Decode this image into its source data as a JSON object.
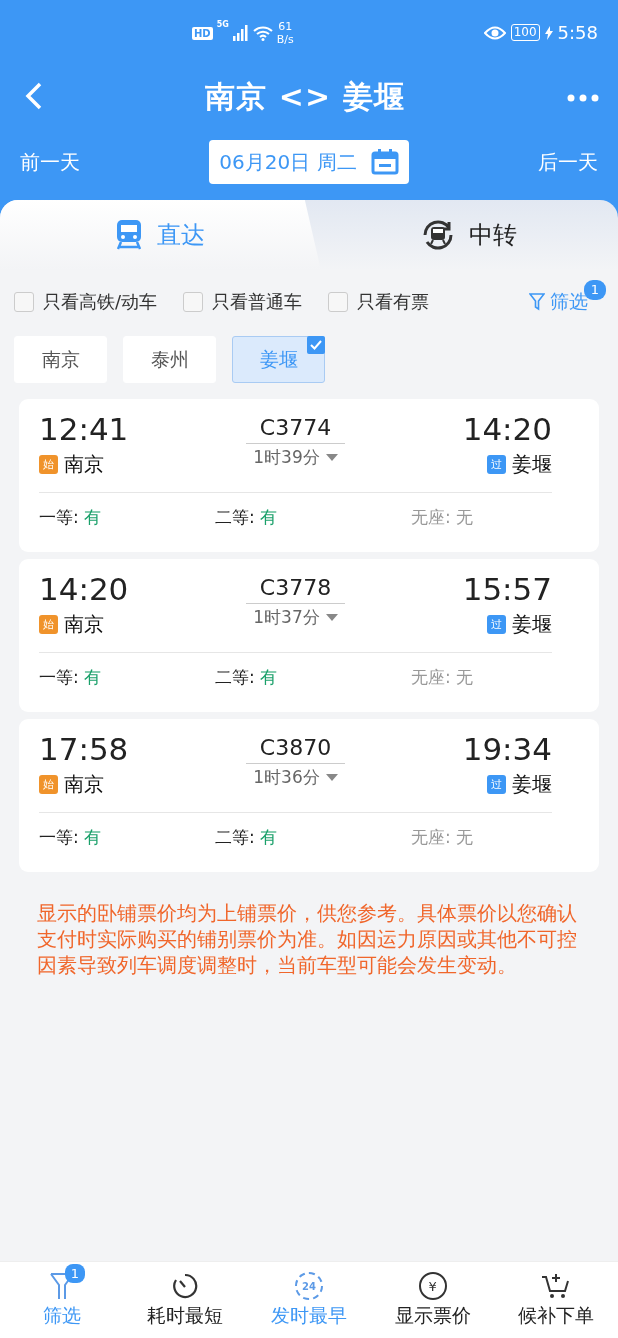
{
  "status_bar": {
    "hd": "HD",
    "network": "5G",
    "speed": "61",
    "speed_unit": "B/s",
    "battery": "100",
    "time": "5:58"
  },
  "header": {
    "title": "南京 <> 姜堰",
    "prev_day": "前一天",
    "date": "06月20日 周二",
    "next_day": "后一天"
  },
  "tabs": [
    {
      "label": "直达",
      "kind": "train",
      "selected": true
    },
    {
      "label": "中转",
      "kind": "transfer",
      "selected": false
    }
  ],
  "filters": [
    {
      "label": "只看高铁/动车",
      "checked": false
    },
    {
      "label": "只看普通车",
      "checked": false
    },
    {
      "label": "只看有票",
      "checked": false
    }
  ],
  "filter_button": {
    "label": "筛选",
    "badge": "1"
  },
  "stations": [
    {
      "label": "南京",
      "selected": false
    },
    {
      "label": "泰州",
      "selected": false
    },
    {
      "label": "姜堰",
      "selected": true
    }
  ],
  "trains": [
    {
      "depart": "12:41",
      "number": "C3774",
      "arrive": "14:20",
      "duration": "1时39分",
      "from_tag": {
        "text": "始",
        "kind": "start"
      },
      "from": "南京",
      "to_tag": {
        "text": "过",
        "kind": "pass"
      },
      "to": "姜堰",
      "seats": [
        {
          "label": "一等:",
          "value": "有",
          "available": true
        },
        {
          "label": "二等:",
          "value": "有",
          "available": true
        },
        {
          "label": "无座:",
          "value": "无",
          "available": false
        }
      ]
    },
    {
      "depart": "14:20",
      "number": "C3778",
      "arrive": "15:57",
      "duration": "1时37分",
      "from_tag": {
        "text": "始",
        "kind": "start"
      },
      "from": "南京",
      "to_tag": {
        "text": "过",
        "kind": "pass"
      },
      "to": "姜堰",
      "seats": [
        {
          "label": "一等:",
          "value": "有",
          "available": true
        },
        {
          "label": "二等:",
          "value": "有",
          "available": true
        },
        {
          "label": "无座:",
          "value": "无",
          "available": false
        }
      ]
    },
    {
      "depart": "17:58",
      "number": "C3870",
      "arrive": "19:34",
      "duration": "1时36分",
      "from_tag": {
        "text": "始",
        "kind": "start"
      },
      "from": "南京",
      "to_tag": {
        "text": "过",
        "kind": "pass"
      },
      "to": "姜堰",
      "seats": [
        {
          "label": "一等:",
          "value": "有",
          "available": true
        },
        {
          "label": "二等:",
          "value": "有",
          "available": true
        },
        {
          "label": "无座:",
          "value": "无",
          "available": false
        }
      ]
    }
  ],
  "notice": "显示的卧铺票价均为上铺票价，供您参考。具体票价以您确认支付时实际购买的铺别票价为准。如因运力原因或其他不可控因素导致列车调度调整时，当前车型可能会发生变动。",
  "bottom_nav": [
    {
      "label": "筛选",
      "kind": "filter",
      "badge": "1",
      "selected": true
    },
    {
      "label": "耗时最短",
      "kind": "timer",
      "selected": false
    },
    {
      "label": "发时最早",
      "kind": "clock",
      "icon_text": "24",
      "selected": true
    },
    {
      "label": "显示票价",
      "kind": "yen",
      "icon_text": "¥",
      "selected": false
    },
    {
      "label": "候补下单",
      "kind": "cart",
      "selected": false
    }
  ]
}
